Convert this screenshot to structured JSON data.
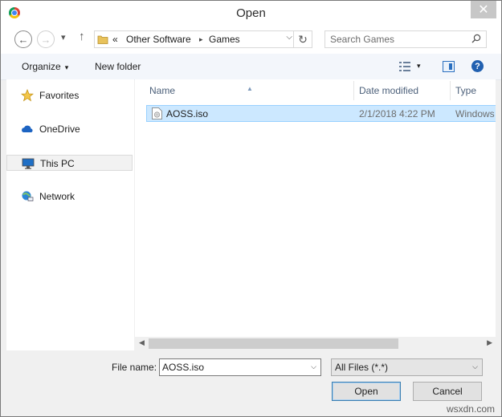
{
  "window": {
    "title": "Open",
    "close_glyph": "✕"
  },
  "nav": {
    "back_glyph": "←",
    "forward_glyph": "→",
    "recent_glyph": "▾",
    "up_glyph": "↑",
    "breadcrumb_prefix": "«",
    "breadcrumb": [
      "Other Software",
      "Games"
    ],
    "breadcrumb_sep": "▸",
    "dropdown_glyph": "⌵",
    "refresh_glyph": "↻"
  },
  "search": {
    "placeholder": "Search Games"
  },
  "toolbar": {
    "organize": "Organize",
    "new_folder": "New folder",
    "caret": "▾",
    "help": "?"
  },
  "sidebar": {
    "items": [
      {
        "label": "Favorites",
        "icon": "star-icon"
      },
      {
        "label": "OneDrive",
        "icon": "cloud-icon"
      },
      {
        "label": "This PC",
        "icon": "computer-icon",
        "selected": true
      },
      {
        "label": "Network",
        "icon": "network-icon"
      }
    ]
  },
  "filelist": {
    "columns": [
      "Name",
      "Date modified",
      "Type"
    ],
    "sort_glyph": "▲",
    "rows": [
      {
        "name": "AOSS.iso",
        "date": "2/1/2018 4:22 PM",
        "type": "Windows",
        "selected": true
      }
    ]
  },
  "scroll": {
    "left_glyph": "◀",
    "right_glyph": "▶"
  },
  "footer": {
    "file_name_label": "File name:",
    "file_name_value": "AOSS.iso",
    "file_type": "All Files (*.*)",
    "caret": "⌵",
    "open_label": "Open",
    "cancel_label": "Cancel"
  },
  "watermark": "wsxdn.com",
  "colors": {
    "selection": "#cce8ff",
    "selection_border": "#99d1ff",
    "accent": "#2160b0"
  }
}
